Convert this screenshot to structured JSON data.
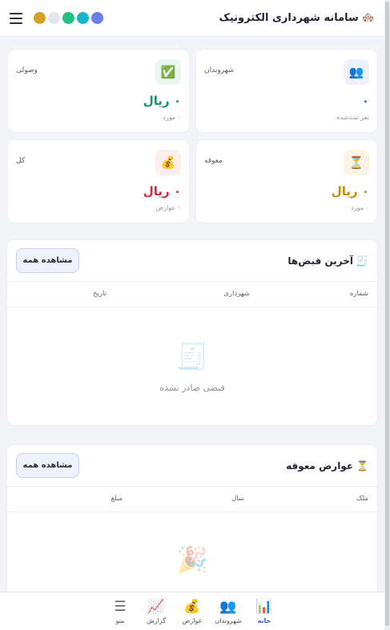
{
  "header": {
    "title": "سامانه شهرداری الکترونیک",
    "brand_icon": "🏘️",
    "theme_dots": [
      "#d4a227",
      "#e2e4ee",
      "#22c083",
      "#16b5c9",
      "#6a7de8"
    ]
  },
  "stats": [
    {
      "label": "شهروندان",
      "icon": "👥",
      "icon_bg": "#eef0fb",
      "value": "۰",
      "value_color": "#3b5bdb",
      "sub": "نفر ثبت‌شده"
    },
    {
      "label": "وصولی",
      "icon": "✅",
      "icon_bg": "#e8f7ef",
      "value": "۰ ریال",
      "value_color": "#12966b",
      "sub": "۰ مورد"
    },
    {
      "label": "معوقه",
      "icon": "⏳",
      "icon_bg": "#fdf3e4",
      "value": "۰ ریال",
      "value_color": "#c98a0c",
      "sub": "۰ مورد"
    },
    {
      "label": "کل",
      "icon": "💰",
      "icon_bg": "#fdeeee",
      "value": "۰ ریال",
      "value_color": "#c9303f",
      "sub": "۰ عوارض"
    }
  ],
  "receipts": {
    "title_icon": "🧾",
    "title": "آخرین قبض‌ها",
    "view_all": "مشاهده همه",
    "columns": [
      "شماره",
      "شهرداری",
      "تاریخ"
    ],
    "empty_icon": "🧾",
    "empty_text": "قبضی صادر نشده"
  },
  "overdue": {
    "title_icon": "⏳",
    "title": "عوارض معوقه",
    "view_all": "مشاهده همه",
    "columns": [
      "ملک",
      "سال",
      "مبلغ"
    ],
    "empty_icon": "🎉"
  },
  "nav": [
    {
      "label": "خانه",
      "icon": "📊",
      "active": true
    },
    {
      "label": "شهروندان",
      "icon": "👥",
      "active": false
    },
    {
      "label": "عوارض",
      "icon": "💰",
      "active": false
    },
    {
      "label": "گزارش",
      "icon": "📈",
      "active": false
    },
    {
      "label": "منو",
      "icon": "☰",
      "active": false
    }
  ]
}
